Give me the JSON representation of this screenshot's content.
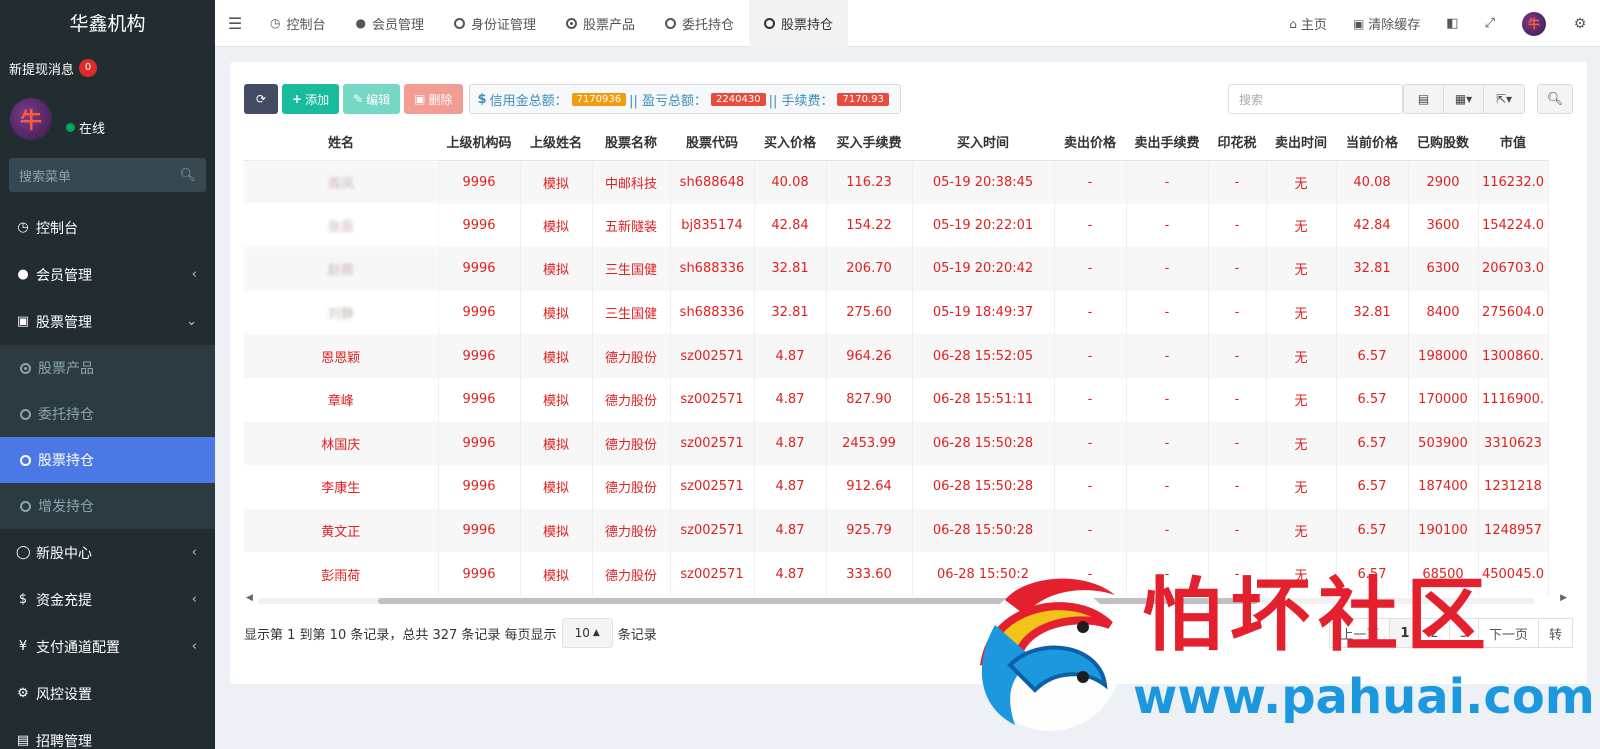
{
  "sidebar": {
    "brand": "华鑫机构",
    "notice_label": "新提现消息",
    "notice_count": "0",
    "avatar_text": "牛",
    "status": "在线",
    "search_placeholder": "搜索菜单",
    "items": [
      {
        "label": "控制台",
        "icon": "dashboard-icon"
      },
      {
        "label": "会员管理",
        "icon": "user-icon"
      },
      {
        "label": "股票管理",
        "icon": "bank-icon"
      }
    ],
    "sub_items": [
      "股票产品",
      "委托持仓",
      "股票持仓",
      "增发持仓"
    ],
    "items2": [
      {
        "label": "新股中心",
        "icon": "circle-icon"
      },
      {
        "label": "资金充提",
        "icon": "dollar-icon"
      },
      {
        "label": "支付通道配置",
        "icon": "yen-icon"
      },
      {
        "label": "风控设置",
        "icon": "gear-icon"
      },
      {
        "label": "招聘管理",
        "icon": "doc-icon"
      }
    ]
  },
  "topnav": {
    "tabs": [
      "控制台",
      "会员管理",
      "身份证管理",
      "股票产品",
      "委托持仓",
      "股票持仓"
    ],
    "home": "主页",
    "clear_cache": "清除缓存",
    "avatar_text": "牛"
  },
  "toolbar": {
    "add": "添加",
    "edit": "编辑",
    "delete": "删除",
    "credit_label": "信用金总额：",
    "credit_value": "7170936",
    "profit_label": "|| 盈亏总额：",
    "profit_value": "2240430",
    "fee_label": "|| 手续费：",
    "fee_value": "7170.93",
    "search_placeholder": "搜索"
  },
  "table": {
    "headers": [
      "姓名",
      "上级机构码",
      "上级姓名",
      "股票名称",
      "股票代码",
      "买入价格",
      "买入手续费",
      "买入时间",
      "卖出价格",
      "卖出手续费",
      "印花税",
      "卖出时间",
      "当前价格",
      "已购股数",
      "市值"
    ],
    "rows": [
      [
        "周凤",
        "9996",
        "模拟",
        "中邮科技",
        "sh688648",
        "40.08",
        "116.23",
        "05-19 20:38:45",
        "-",
        "-",
        "-",
        "无",
        "40.08",
        "2900",
        "116232.0"
      ],
      [
        "张辰",
        "9996",
        "模拟",
        "五新隧装",
        "bj835174",
        "42.84",
        "154.22",
        "05-19 20:22:01",
        "-",
        "-",
        "-",
        "无",
        "42.84",
        "3600",
        "154224.0"
      ],
      [
        "赵鼎",
        "9996",
        "模拟",
        "三生国健",
        "sh688336",
        "32.81",
        "206.70",
        "05-19 20:20:42",
        "-",
        "-",
        "-",
        "无",
        "32.81",
        "6300",
        "206703.0"
      ],
      [
        "刘静",
        "9996",
        "模拟",
        "三生国健",
        "sh688336",
        "32.81",
        "275.60",
        "05-19 18:49:37",
        "-",
        "-",
        "-",
        "无",
        "32.81",
        "8400",
        "275604.0"
      ],
      [
        "恩恩颖",
        "9996",
        "模拟",
        "德力股份",
        "sz002571",
        "4.87",
        "964.26",
        "06-28 15:52:05",
        "-",
        "-",
        "-",
        "无",
        "6.57",
        "198000",
        "1300860."
      ],
      [
        "章峰",
        "9996",
        "模拟",
        "德力股份",
        "sz002571",
        "4.87",
        "827.90",
        "06-28 15:51:11",
        "-",
        "-",
        "-",
        "无",
        "6.57",
        "170000",
        "1116900."
      ],
      [
        "林国庆",
        "9996",
        "模拟",
        "德力股份",
        "sz002571",
        "4.87",
        "2453.99",
        "06-28 15:50:28",
        "-",
        "-",
        "-",
        "无",
        "6.57",
        "503900",
        "3310623"
      ],
      [
        "李康生",
        "9996",
        "模拟",
        "德力股份",
        "sz002571",
        "4.87",
        "912.64",
        "06-28 15:50:28",
        "-",
        "-",
        "-",
        "无",
        "6.57",
        "187400",
        "1231218"
      ],
      [
        "黄文正",
        "9996",
        "模拟",
        "德力股份",
        "sz002571",
        "4.87",
        "925.79",
        "06-28 15:50:28",
        "-",
        "-",
        "-",
        "无",
        "6.57",
        "190100",
        "1248957"
      ],
      [
        "彭雨荷",
        "9996",
        "模拟",
        "德力股份",
        "sz002571",
        "4.87",
        "333.60",
        "06-28 15:50:2",
        "-",
        "-",
        "-",
        "无",
        "6.57",
        "68500",
        "450045.0"
      ]
    ]
  },
  "footer": {
    "info": "显示第 1 到第 10 条记录，总共 327 条记录 每页显示",
    "page_size": "10",
    "suffix": "条记录",
    "pages": [
      "上一页",
      "1",
      "2",
      "3",
      "下一页",
      "转"
    ]
  },
  "watermark": {
    "text": "怕坏社区",
    "url": "www.pahuai.com"
  }
}
